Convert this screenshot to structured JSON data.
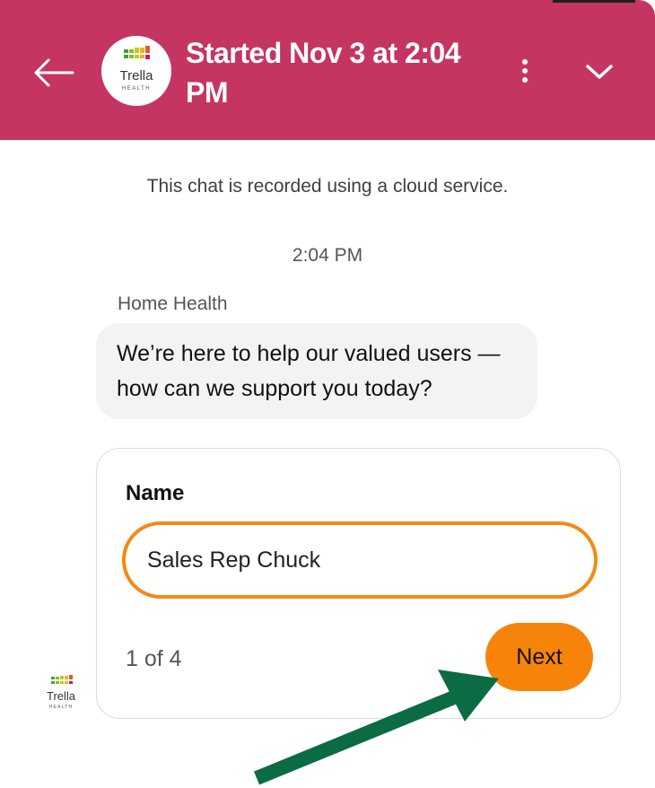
{
  "header": {
    "title": "Started Nov 3 at 2:04 PM",
    "background_color": "#c43661",
    "logo": {
      "name": "Trella",
      "subtitle": "HEALTH"
    },
    "back_icon": "arrow-left-icon",
    "more_icon": "vertical-dots-icon",
    "collapse_icon": "chevron-down-icon"
  },
  "chat": {
    "notice": "This chat is recorded using a cloud service.",
    "timestamp": "2:04 PM",
    "sender": "Home Health",
    "message": "We’re here to help our valued users — how can we support you today?"
  },
  "form": {
    "label": "Name",
    "input_value": "Sales Rep Chuck",
    "step": "1 of 4",
    "next_label": "Next",
    "accent_color": "#f6840a"
  },
  "bot_logo": {
    "name": "Trella",
    "subtitle": "HEALTH"
  },
  "annotation": {
    "icon": "green-pointer-arrow-icon",
    "color": "#0b6b43"
  }
}
